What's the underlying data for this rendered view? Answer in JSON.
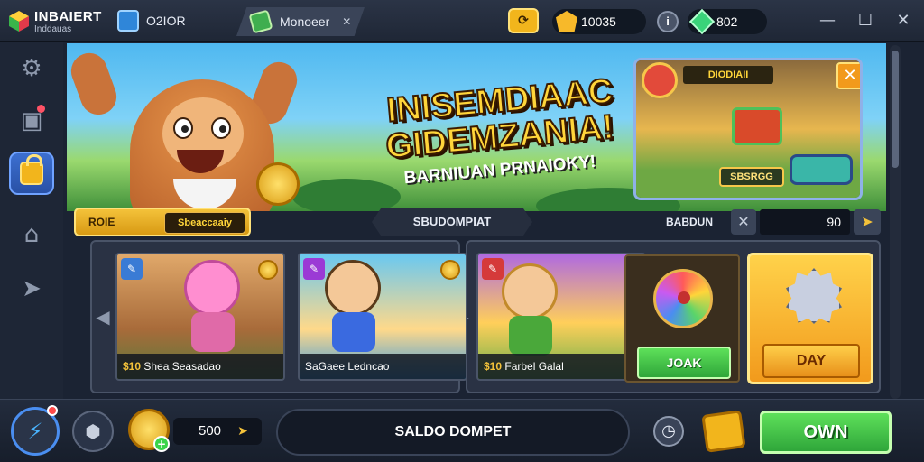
{
  "app": {
    "brand_name": "INBAIERT",
    "brand_sub": "Inddauas"
  },
  "tabs": [
    {
      "label": "O2IOR",
      "icon": "folder-icon"
    },
    {
      "label": "Monoeer",
      "icon": "cube-icon"
    }
  ],
  "resources": {
    "gold": "10035",
    "gems": "802"
  },
  "sidebar": {
    "items": [
      {
        "name": "settings",
        "icon": "gear-icon"
      },
      {
        "name": "inbox",
        "icon": "mailbox-icon"
      },
      {
        "name": "shop",
        "icon": "lock-icon"
      },
      {
        "name": "home",
        "icon": "house-icon"
      },
      {
        "name": "launch",
        "icon": "paper-plane-icon"
      }
    ]
  },
  "banner": {
    "headline_l1": "INISEMDIAAC",
    "headline_l2": "GIDEMZANIA!",
    "subline": "BARNIUAN PRNAIOKY!",
    "promo_title": "DIODIAII",
    "promo_button": "SBSRGG"
  },
  "filters": {
    "main_label": "ROIE",
    "main_value": "Sbeaccaaiy",
    "center_label": "SBUDOMPIAT",
    "sort_label": "BABDUN",
    "sort_value": "90"
  },
  "cards": [
    {
      "price": "$10",
      "title": "Shea Seasadao",
      "tag_color": "#3a7bd5"
    },
    {
      "price": "",
      "title": "SaGaee Ledncao",
      "tag_color": "#9b3ad5"
    },
    {
      "price": "$10",
      "title": "Farbel Galal",
      "tag_color": "#d53a3a"
    }
  ],
  "gem_card": {
    "button": "JOAK"
  },
  "day_card": {
    "button": "DAY"
  },
  "bottom": {
    "balance": "500",
    "wallet_label": "SALDO DOMPET",
    "own_label": "OWN"
  },
  "colors": {
    "accent": "#f4c23a",
    "green": "#3ad44a",
    "panel": "#2a3244"
  }
}
